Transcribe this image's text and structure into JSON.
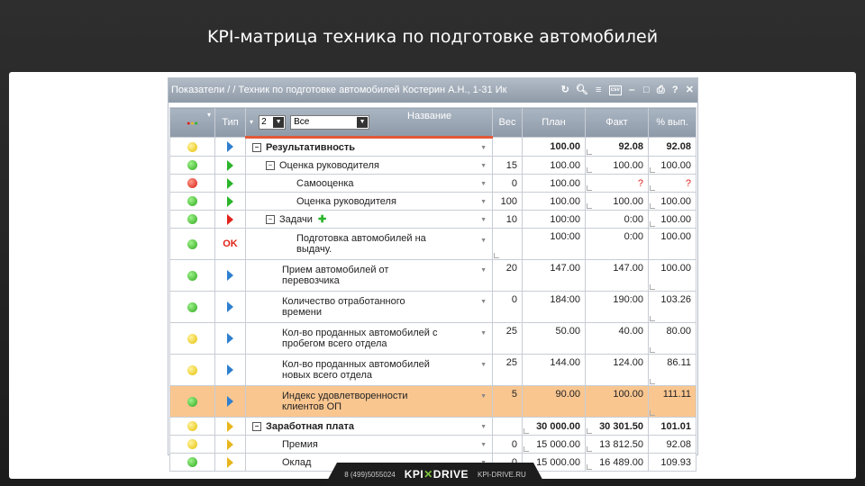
{
  "slide": {
    "title": "KPI-матрица техника по подготовке автомобилей"
  },
  "window": {
    "title": "Показатели / / Техник по подготовке автомобилей Костерин А.Н., 1-31 Ик",
    "icons": [
      "refresh-icon",
      "search-icon",
      "list-icon",
      "csv-icon",
      "minimize-icon",
      "maximize-icon",
      "print-icon",
      "help-icon",
      "close-icon"
    ]
  },
  "header": {
    "status": "",
    "type": "Тип",
    "level_value": "2",
    "filter_value": "Все",
    "name": "Название",
    "weight": "Вес",
    "plan": "План",
    "fact": "Факт",
    "pct": "% вып."
  },
  "rows": [
    {
      "status": "yellow",
      "type": "blue",
      "name": "Результативность",
      "weight": "",
      "plan": "100.00",
      "fact": "92.08",
      "pct": "92.08"
    },
    {
      "status": "green",
      "type": "green",
      "name": "Оценка руководителя",
      "weight": "15",
      "plan": "100.00",
      "fact": "100.00",
      "pct": "100.00"
    },
    {
      "status": "red",
      "type": "green",
      "name": "Самооценка",
      "weight": "0",
      "plan": "100.00",
      "fact": "?",
      "pct": "?"
    },
    {
      "status": "green",
      "type": "green",
      "name": "Оценка руководителя",
      "weight": "100",
      "plan": "100.00",
      "fact": "100.00",
      "pct": "100.00"
    },
    {
      "status": "green",
      "type": "red",
      "name": "Задачи",
      "weight": "10",
      "plan": "100:00",
      "fact": "0:00",
      "pct": "100.00"
    },
    {
      "status": "green",
      "type": "OK",
      "name": "Подготовка автомобилей на выдачу.",
      "weight": "",
      "plan": "100:00",
      "fact": "0:00",
      "pct": "100.00"
    },
    {
      "status": "green",
      "type": "blue",
      "name": "Прием автомобилей от перевозчика",
      "weight": "20",
      "plan": "147.00",
      "fact": "147.00",
      "pct": "100.00"
    },
    {
      "status": "green",
      "type": "blue",
      "name": "Количество отработанного времени",
      "weight": "0",
      "plan": "184:00",
      "fact": "190:00",
      "pct": "103.26"
    },
    {
      "status": "yellow",
      "type": "blue",
      "name": "Кол-во проданных автомобилей с пробегом всего отдела",
      "weight": "25",
      "plan": "50.00",
      "fact": "40.00",
      "pct": "80.00"
    },
    {
      "status": "yellow",
      "type": "blue",
      "name": "Кол-во проданных автомобилей новых всего отдела",
      "weight": "25",
      "plan": "144.00",
      "fact": "124.00",
      "pct": "86.11"
    },
    {
      "status": "green",
      "type": "blue",
      "name": "Индекс удовлетворенности клиентов ОП",
      "weight": "5",
      "plan": "90.00",
      "fact": "100.00",
      "pct": "111.11"
    },
    {
      "status": "yellow",
      "type": "yellow",
      "name": "Заработная плата",
      "weight": "",
      "plan": "30 000.00",
      "fact": "30 301.50",
      "pct": "101.01"
    },
    {
      "status": "yellow",
      "type": "yellow",
      "name": "Премия",
      "weight": "0",
      "plan": "15 000.00",
      "fact": "13 812.50",
      "pct": "92.08"
    },
    {
      "status": "green",
      "type": "yellow",
      "name": "Оклад",
      "weight": "0",
      "plan": "15 000.00",
      "fact": "16 489.00",
      "pct": "109.93"
    }
  ],
  "footer": {
    "phone": "8 (499)5055024",
    "logo_left": "KPI",
    "logo_right": "DRIVE",
    "site": "KPI-DRIVE.RU"
  }
}
